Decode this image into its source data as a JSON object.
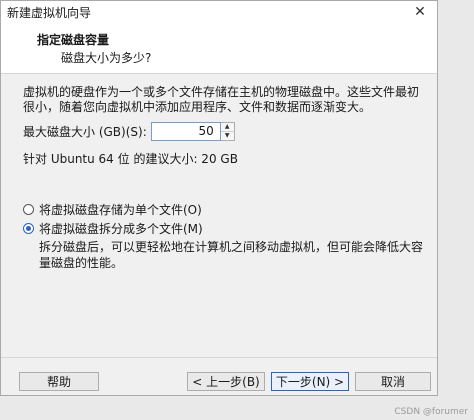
{
  "window": {
    "title": "新建虚拟机向导",
    "close_glyph": "✕"
  },
  "header": {
    "title": "指定磁盘容量",
    "subtitle": "磁盘大小为多少?"
  },
  "description": "虚拟机的硬盘作为一个或多个文件存储在主机的物理磁盘中。这些文件最初很小，随着您向虚拟机中添加应用程序、文件和数据而逐渐变大。",
  "disk": {
    "label": "最大磁盘大小 (GB)(S):",
    "value": "50"
  },
  "recommendation": "针对 Ubuntu 64 位 的建议大小: 20 GB",
  "options": [
    {
      "label": "将虚拟磁盘存储为单个文件(O)",
      "selected": false
    },
    {
      "label": "将虚拟磁盘拆分成多个文件(M)",
      "selected": true
    }
  ],
  "split_note": "拆分磁盘后，可以更轻松地在计算机之间移动虚拟机，但可能会降低大容量磁盘的性能。",
  "buttons": {
    "help": "帮助",
    "back": "< 上一步(B)",
    "next": "下一步(N) >",
    "cancel": "取消"
  },
  "watermark": "CSDN @forumer"
}
